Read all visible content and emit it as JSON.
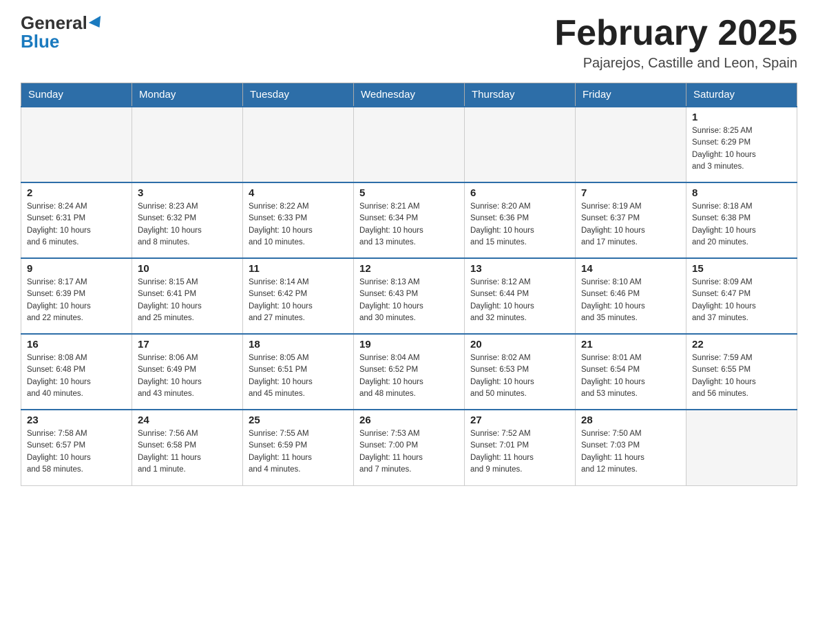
{
  "header": {
    "logo_general": "General",
    "logo_blue": "Blue",
    "title": "February 2025",
    "subtitle": "Pajarejos, Castille and Leon, Spain"
  },
  "days_of_week": [
    "Sunday",
    "Monday",
    "Tuesday",
    "Wednesday",
    "Thursday",
    "Friday",
    "Saturday"
  ],
  "weeks": [
    [
      {
        "day": "",
        "info": ""
      },
      {
        "day": "",
        "info": ""
      },
      {
        "day": "",
        "info": ""
      },
      {
        "day": "",
        "info": ""
      },
      {
        "day": "",
        "info": ""
      },
      {
        "day": "",
        "info": ""
      },
      {
        "day": "1",
        "info": "Sunrise: 8:25 AM\nSunset: 6:29 PM\nDaylight: 10 hours\nand 3 minutes."
      }
    ],
    [
      {
        "day": "2",
        "info": "Sunrise: 8:24 AM\nSunset: 6:31 PM\nDaylight: 10 hours\nand 6 minutes."
      },
      {
        "day": "3",
        "info": "Sunrise: 8:23 AM\nSunset: 6:32 PM\nDaylight: 10 hours\nand 8 minutes."
      },
      {
        "day": "4",
        "info": "Sunrise: 8:22 AM\nSunset: 6:33 PM\nDaylight: 10 hours\nand 10 minutes."
      },
      {
        "day": "5",
        "info": "Sunrise: 8:21 AM\nSunset: 6:34 PM\nDaylight: 10 hours\nand 13 minutes."
      },
      {
        "day": "6",
        "info": "Sunrise: 8:20 AM\nSunset: 6:36 PM\nDaylight: 10 hours\nand 15 minutes."
      },
      {
        "day": "7",
        "info": "Sunrise: 8:19 AM\nSunset: 6:37 PM\nDaylight: 10 hours\nand 17 minutes."
      },
      {
        "day": "8",
        "info": "Sunrise: 8:18 AM\nSunset: 6:38 PM\nDaylight: 10 hours\nand 20 minutes."
      }
    ],
    [
      {
        "day": "9",
        "info": "Sunrise: 8:17 AM\nSunset: 6:39 PM\nDaylight: 10 hours\nand 22 minutes."
      },
      {
        "day": "10",
        "info": "Sunrise: 8:15 AM\nSunset: 6:41 PM\nDaylight: 10 hours\nand 25 minutes."
      },
      {
        "day": "11",
        "info": "Sunrise: 8:14 AM\nSunset: 6:42 PM\nDaylight: 10 hours\nand 27 minutes."
      },
      {
        "day": "12",
        "info": "Sunrise: 8:13 AM\nSunset: 6:43 PM\nDaylight: 10 hours\nand 30 minutes."
      },
      {
        "day": "13",
        "info": "Sunrise: 8:12 AM\nSunset: 6:44 PM\nDaylight: 10 hours\nand 32 minutes."
      },
      {
        "day": "14",
        "info": "Sunrise: 8:10 AM\nSunset: 6:46 PM\nDaylight: 10 hours\nand 35 minutes."
      },
      {
        "day": "15",
        "info": "Sunrise: 8:09 AM\nSunset: 6:47 PM\nDaylight: 10 hours\nand 37 minutes."
      }
    ],
    [
      {
        "day": "16",
        "info": "Sunrise: 8:08 AM\nSunset: 6:48 PM\nDaylight: 10 hours\nand 40 minutes."
      },
      {
        "day": "17",
        "info": "Sunrise: 8:06 AM\nSunset: 6:49 PM\nDaylight: 10 hours\nand 43 minutes."
      },
      {
        "day": "18",
        "info": "Sunrise: 8:05 AM\nSunset: 6:51 PM\nDaylight: 10 hours\nand 45 minutes."
      },
      {
        "day": "19",
        "info": "Sunrise: 8:04 AM\nSunset: 6:52 PM\nDaylight: 10 hours\nand 48 minutes."
      },
      {
        "day": "20",
        "info": "Sunrise: 8:02 AM\nSunset: 6:53 PM\nDaylight: 10 hours\nand 50 minutes."
      },
      {
        "day": "21",
        "info": "Sunrise: 8:01 AM\nSunset: 6:54 PM\nDaylight: 10 hours\nand 53 minutes."
      },
      {
        "day": "22",
        "info": "Sunrise: 7:59 AM\nSunset: 6:55 PM\nDaylight: 10 hours\nand 56 minutes."
      }
    ],
    [
      {
        "day": "23",
        "info": "Sunrise: 7:58 AM\nSunset: 6:57 PM\nDaylight: 10 hours\nand 58 minutes."
      },
      {
        "day": "24",
        "info": "Sunrise: 7:56 AM\nSunset: 6:58 PM\nDaylight: 11 hours\nand 1 minute."
      },
      {
        "day": "25",
        "info": "Sunrise: 7:55 AM\nSunset: 6:59 PM\nDaylight: 11 hours\nand 4 minutes."
      },
      {
        "day": "26",
        "info": "Sunrise: 7:53 AM\nSunset: 7:00 PM\nDaylight: 11 hours\nand 7 minutes."
      },
      {
        "day": "27",
        "info": "Sunrise: 7:52 AM\nSunset: 7:01 PM\nDaylight: 11 hours\nand 9 minutes."
      },
      {
        "day": "28",
        "info": "Sunrise: 7:50 AM\nSunset: 7:03 PM\nDaylight: 11 hours\nand 12 minutes."
      },
      {
        "day": "",
        "info": ""
      }
    ]
  ]
}
